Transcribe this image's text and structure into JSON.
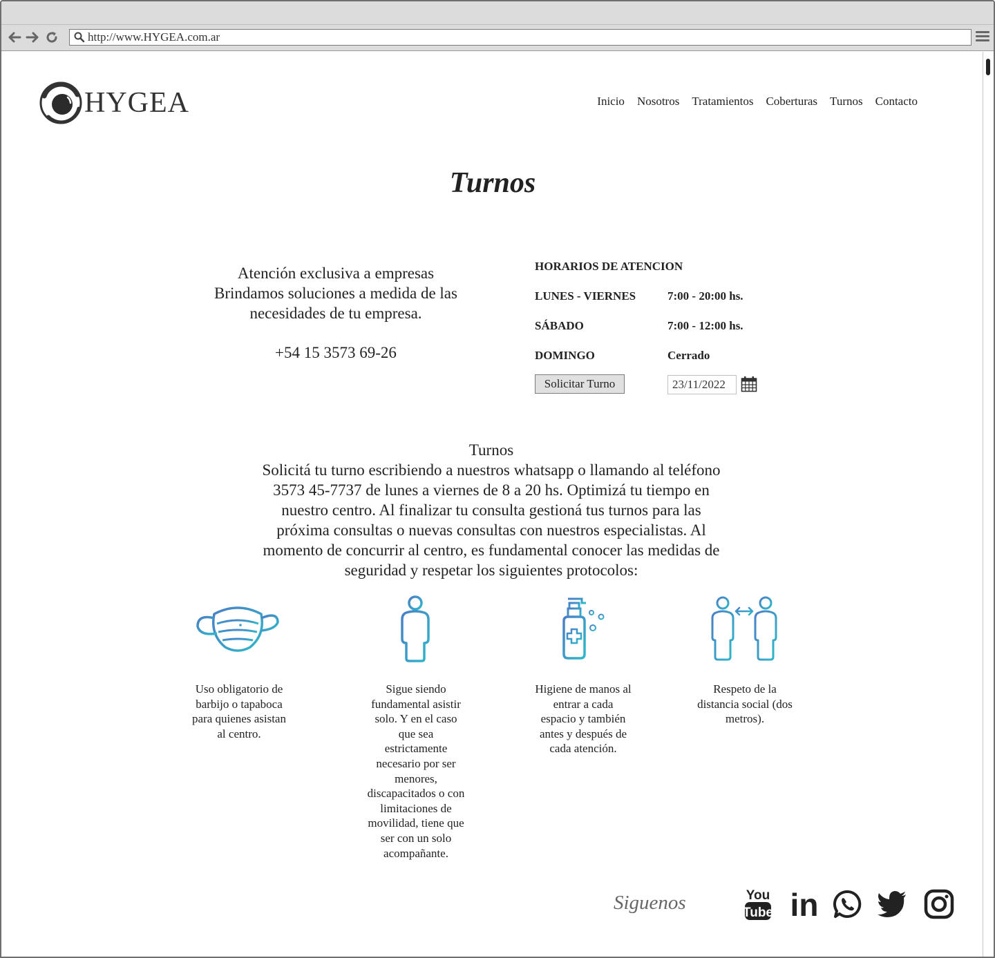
{
  "browser": {
    "url": "http://www.HYGEA.com.ar"
  },
  "header": {
    "logo_text": "HYGEA",
    "nav": [
      "Inicio",
      "Nosotros",
      "Tratamientos",
      "Coberturas",
      "Turnos",
      "Contacto"
    ]
  },
  "main": {
    "title": "Turnos",
    "intro": {
      "line1": "Atención exclusiva a empresas",
      "line2": "Brindamos soluciones a medida de las",
      "line3": "necesidades de tu empresa.",
      "phone": "+54 15 3573 69-26"
    },
    "hours": {
      "heading": "HORARIOS DE ATENCION",
      "rows": [
        {
          "day": "LUNES - VIERNES",
          "time": "7:00 - 20:00 hs."
        },
        {
          "day": "SÁBADO",
          "time": "7:00 - 12:00 hs."
        },
        {
          "day": "DOMINGO",
          "time": "Cerrado"
        }
      ],
      "button_label": "Solicitar Turno",
      "date_value": "23/11/2022"
    },
    "turnos": {
      "heading": "Turnos",
      "lines": [
        "Solicitá tu turno escribiendo a nuestros whatsapp o llamando al teléfono",
        "3573 45-7737 de lunes a viernes de 8 a 20 hs. Optimizá tu tiempo en",
        "nuestro centro. Al finalizar tu consulta gestioná tus turnos para las",
        "próxima consultas o nuevas consultas con nuestros especialistas. Al",
        "momento de concurrir al centro, es fundamental conocer las medidas de",
        "seguridad y respetar los siguientes protocolos:"
      ]
    },
    "protocols": [
      {
        "icon": "face-mask-icon",
        "lines": [
          "Uso obligatorio de",
          "barbijo o tapaboca",
          "para quienes asistan",
          "al centro."
        ]
      },
      {
        "icon": "person-icon",
        "lines": [
          "Sigue siendo",
          "fundamental asistir",
          "solo. Y en el caso",
          "que sea",
          "estrictamente",
          "necesario por ser",
          "menores,",
          "discapacitados o con",
          "limitaciones de",
          "movilidad, tiene que",
          "ser con un solo",
          "acompañante."
        ]
      },
      {
        "icon": "hand-sanitizer-icon",
        "lines": [
          "Higiene de manos al",
          "entrar a cada",
          "espacio y también",
          "antes y después de",
          "cada atención."
        ]
      },
      {
        "icon": "social-distance-icon",
        "lines": [
          "Respeto de la",
          "distancia social (dos",
          "metros)."
        ]
      }
    ]
  },
  "footer": {
    "follow_label": "Siguenos",
    "social_icons": [
      "youtube-icon",
      "linkedin-icon",
      "whatsapp-icon",
      "twitter-icon",
      "instagram-icon"
    ],
    "youtube_you": "You",
    "youtube_tube": "Tube",
    "linkedin_text": "in"
  },
  "colors": {
    "icon_gradient_start": "#4a7fc7",
    "icon_gradient_end": "#2fb8c9",
    "text": "#222222",
    "chrome": "#dcdcdc"
  }
}
